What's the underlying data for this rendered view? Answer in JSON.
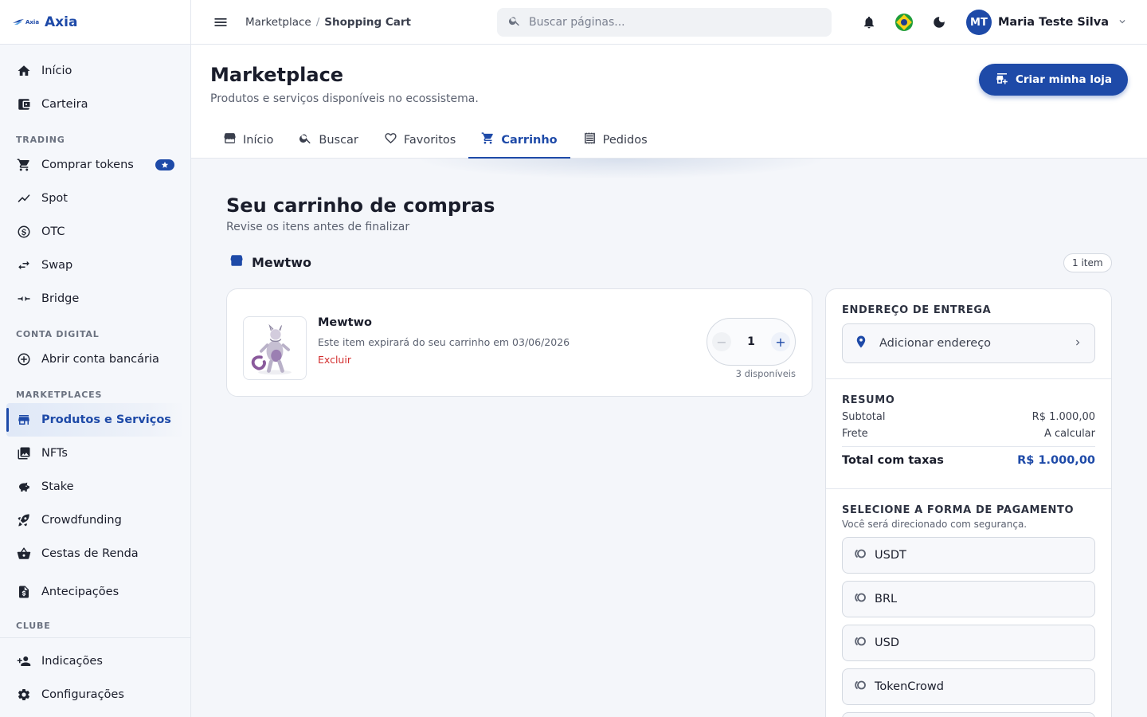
{
  "brand": {
    "logo_text": "Axia",
    "name": "Axia"
  },
  "sidebar": {
    "items_top": [
      {
        "label": "Início",
        "icon": "home-icon"
      },
      {
        "label": "Carteira",
        "icon": "wallet-icon"
      }
    ],
    "section_trading": "TRADING",
    "items_trading": [
      {
        "label": "Comprar tokens",
        "icon": "cart-icon"
      },
      {
        "label": "Spot",
        "icon": "trend-icon"
      },
      {
        "label": "OTC",
        "icon": "otc-icon"
      },
      {
        "label": "Swap",
        "icon": "swap-icon"
      },
      {
        "label": "Bridge",
        "icon": "bridge-icon"
      }
    ],
    "section_conta": "CONTA DIGITAL",
    "items_conta": [
      {
        "label": "Abrir conta bancária",
        "icon": "plus-circle-icon"
      }
    ],
    "section_market": "MARKETPLACES",
    "items_market": [
      {
        "label": "Produtos e Serviços",
        "icon": "store-icon"
      },
      {
        "label": "NFTs",
        "icon": "image-icon"
      },
      {
        "label": "Stake",
        "icon": "piggy-icon"
      },
      {
        "label": "Crowdfunding",
        "icon": "rocket-icon"
      },
      {
        "label": "Cestas de Renda",
        "icon": "basket-icon"
      },
      {
        "label": "Antecipações",
        "icon": "invoice-icon"
      }
    ],
    "section_clube": "CLUBE",
    "items_bottom": [
      {
        "label": "Indicações",
        "icon": "person-add-icon"
      },
      {
        "label": "Configurações",
        "icon": "gear-icon"
      }
    ]
  },
  "topbar": {
    "breadcrumb": [
      "Marketplace",
      "Shopping Cart"
    ],
    "search_placeholder": "Buscar páginas...",
    "user_initials": "MT",
    "user_name": "Maria Teste Silva"
  },
  "header": {
    "title": "Marketplace",
    "subtitle": "Produtos e serviços disponíveis no ecossistema.",
    "create_button": "Criar minha loja",
    "tabs": [
      {
        "label": "Início",
        "icon": "store-icon"
      },
      {
        "label": "Buscar",
        "icon": "search-icon"
      },
      {
        "label": "Favoritos",
        "icon": "heart-icon"
      },
      {
        "label": "Carrinho",
        "icon": "cart-icon"
      },
      {
        "label": "Pedidos",
        "icon": "receipt-icon"
      }
    ],
    "active_tab": "Carrinho"
  },
  "cart": {
    "title": "Seu carrinho de compras",
    "subtitle": "Revise os itens antes de finalizar",
    "store_name": "Mewtwo",
    "item_count": "1 item",
    "item": {
      "name": "Mewtwo",
      "expiry": "Este item expirará do seu carrinho em 03/06/2026",
      "delete": "Excluir",
      "quantity": "1",
      "available": "3 disponíveis"
    }
  },
  "summary": {
    "address_label": "ENDEREÇO DE ENTREGA",
    "address_button": "Adicionar endereço",
    "summary_label": "RESUMO",
    "subtotal_label": "Subtotal",
    "subtotal_value": "R$ 1.000,00",
    "shipping_label": "Frete",
    "shipping_value": "A calcular",
    "total_label": "Total com taxas",
    "total_value": "R$ 1.000,00",
    "payment_label": "SELECIONE A FORMA DE PAGAMENTO",
    "payment_hint": "Você será direcionado com segurança.",
    "payment_options": [
      "USDT",
      "BRL",
      "USD",
      "TokenCrowd"
    ]
  },
  "colors": {
    "accent": "#1e4aa8",
    "danger": "#d32f2f"
  }
}
